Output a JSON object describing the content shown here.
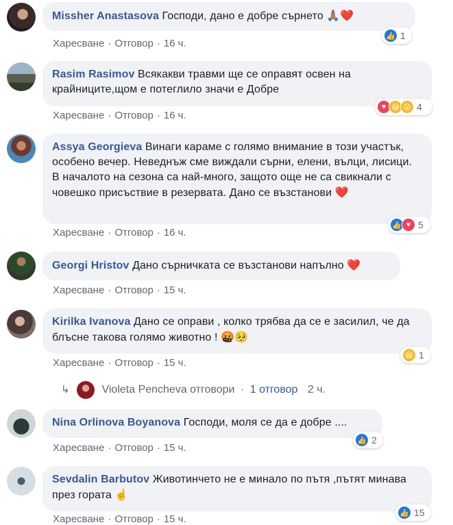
{
  "actions": {
    "like": "Харесване",
    "reply": "Отговор"
  },
  "comments": [
    {
      "author": "Missher Anastasova",
      "text": "Господи, дано е добре сърнето",
      "emoji": "🙏🏽❤️",
      "time": "16 ч.",
      "reactions": "1"
    },
    {
      "author": "Rasim Rasimov",
      "text": "Всякакви травми ще се оправят освен на крайниците,щом е потеглило значи е Добре",
      "time": "16 ч.",
      "reactions": "4"
    },
    {
      "author": "Assya Georgieva",
      "text": "Винаги караме с голямо внимание в този участък, особено вечер. Неведнъж сме виждали сърни, елени, вълци, лисици. В началото на сезона са най-много, защото още не са свикнали с човешко присъствие в резервата. Дано се възстанови",
      "emoji": "❤️",
      "time": "16 ч.",
      "reactions": "5"
    },
    {
      "author": "Georgi Hristov",
      "text": "Дано сърничката се възстанови напълно",
      "emoji": "❤️",
      "time": "15 ч."
    },
    {
      "author": "Kirilka Ivanova",
      "text": "Дано се оправи , колко трябва да се е засилил, че да блъсне такова голямо животно !",
      "emoji": "🤬🥺",
      "time": "15 ч.",
      "reactions": "1"
    },
    {
      "author": "Nina Orlinova Boyanova",
      "text": "Господи, моля се да е добре ....",
      "time": "15 ч.",
      "reactions": "2"
    },
    {
      "author": "Sevdalin Barbutov",
      "text": "Животинчето не е минало по пътя ,пътят минава през гората",
      "emoji": "☝️",
      "time": "15 ч.",
      "reactions": "15"
    }
  ],
  "reply": {
    "author_action": "Violeta Pencheva отговори",
    "count": "1 отговор",
    "time": "2 ч."
  },
  "colors": {
    "link": "#385898",
    "bubble": "#f0f2f5",
    "like": "#1877f2",
    "love": "#f33e58"
  }
}
